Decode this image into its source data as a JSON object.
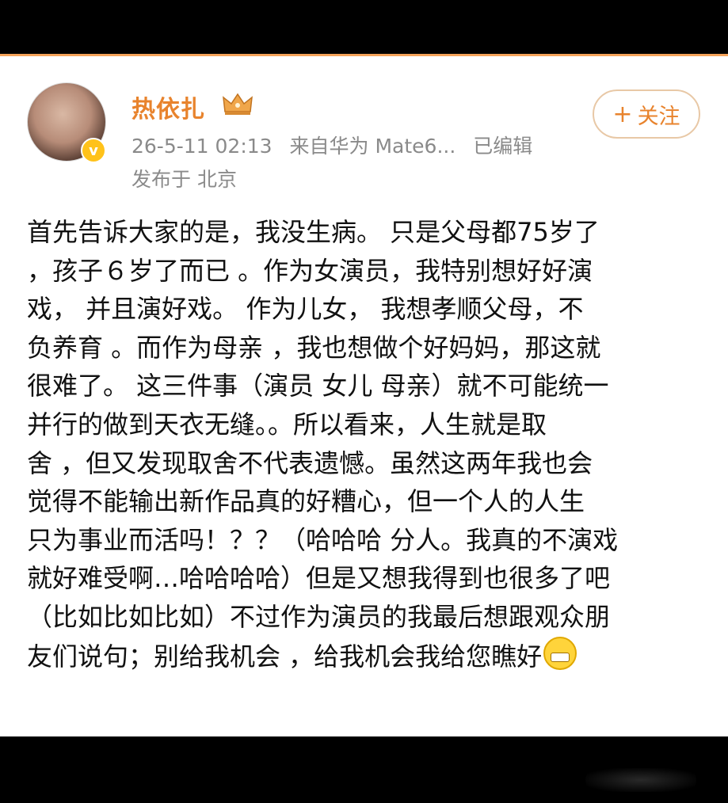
{
  "profile": {
    "username": "热依扎",
    "verified_badge_icon": "verified-v-icon",
    "crown_icon": "crown-icon",
    "timestamp": "26-5-11 02:13",
    "source": "来自华为 Mate6...",
    "edited": "已编辑",
    "location": "发布于 北京",
    "accent_color": "#e8832d"
  },
  "follow_button": {
    "plus": "+",
    "label": "关注"
  },
  "post": {
    "lines": [
      "首先告诉大家的是，我没生病。 只是父母都75岁了",
      "，孩子６岁了而已 。作为女演员，我特别想好好演",
      "戏， 并且演好戏。 作为儿女， 我想孝顺父母，不",
      "负养育 。而作为母亲 ，我也想做个好妈妈，那这就",
      "很难了。 这三件事（演员 女儿 母亲）就不可能统一",
      "并行的做到天衣无缝。。所以看来，人生就是取",
      "舍 ，但又发现取舍不代表遗憾。虽然这两年我也会",
      "觉得不能输出新作品真的好糟心，但一个人的人生",
      "只为事业而活吗！？？（哈哈哈 分人。我真的不演戏",
      "就好难受啊…哈哈哈哈）但是又想我得到也很多了吧",
      "（比如比如比如）不过作为演员的我最后想跟观众朋",
      "友们说句；别给我机会 ，给我机会我给您瞧好"
    ],
    "trailing_emoji": "grin-emoji"
  }
}
